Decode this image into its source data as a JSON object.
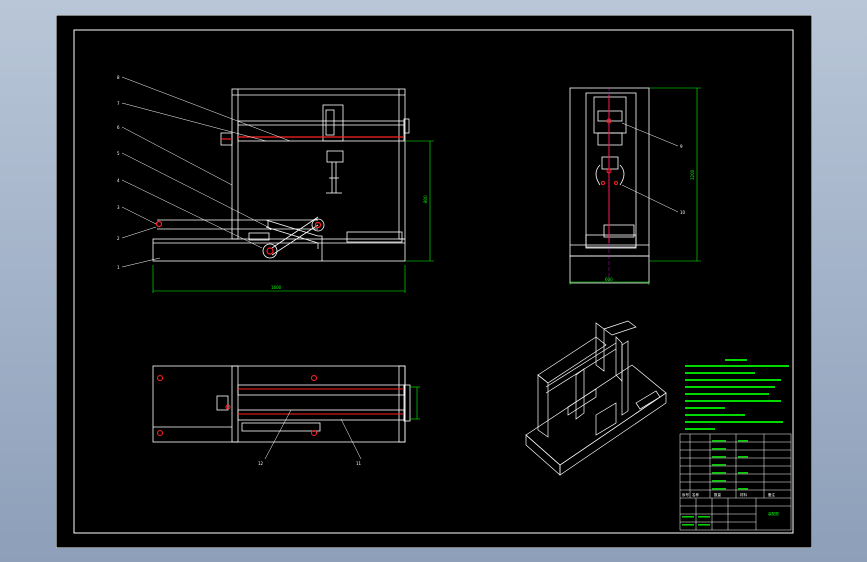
{
  "colors": {
    "background_top": "#b9c6d8",
    "background_bottom": "#8d9fb9",
    "paper": "#000000",
    "line": "#ffffff",
    "dimension": "#00ff00",
    "highlight": "#ff2020",
    "hidden_line": "#ff00ff"
  },
  "front_view": {
    "part_labels": [
      "8",
      "7",
      "6",
      "5",
      "4",
      "3",
      "2",
      "1"
    ],
    "dimensions": {
      "overall_width": "1600",
      "height": "800"
    }
  },
  "side_view": {
    "part_labels": [
      "9",
      "10"
    ],
    "dimensions": {
      "width": "600",
      "height": "1200"
    }
  },
  "top_view": {
    "part_labels": [
      "12",
      "11"
    ]
  },
  "title_block": {
    "header_row": [
      "序号",
      "名称",
      "数量",
      "材料",
      "备注"
    ],
    "title": "装配图",
    "rows": 9
  }
}
